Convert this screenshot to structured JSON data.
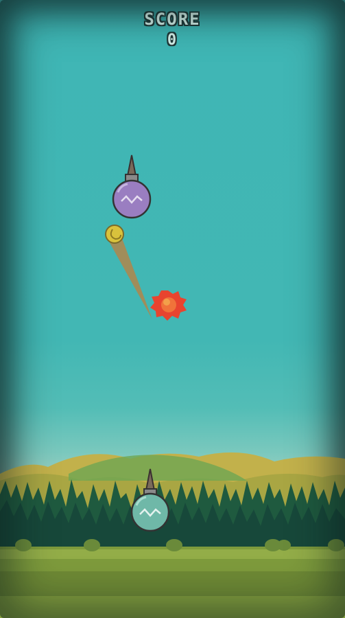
{
  "hud": {
    "score_label": "SCORE",
    "score_value": "0"
  },
  "palette": {
    "sky": "#42b7b4",
    "ground": "#7e9b3c",
    "grass_light": "#93ad48",
    "forest": "#1f5a3f",
    "hills": "#c7b24c",
    "enemy_ornament": "#9a7ec1",
    "player_ornament": "#6fb8a8",
    "coin": "#d9c23c",
    "explosion": "#e8442f"
  },
  "sprites": {
    "enemy": "purple-ornament-bomb",
    "player": "teal-ornament-bomb-cannon",
    "projectile": "gold-coin-with-trail",
    "explosion": "red-burst"
  }
}
